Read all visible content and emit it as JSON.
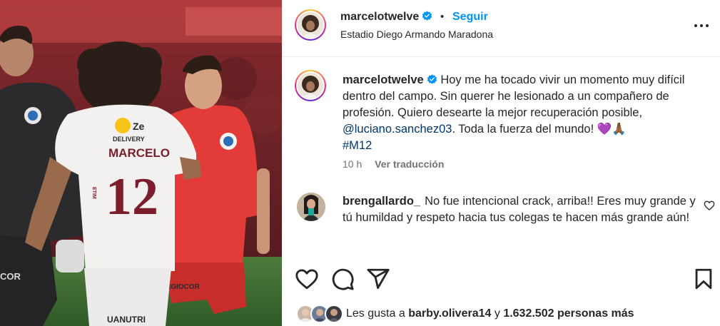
{
  "post": {
    "username": "marcelotwelve",
    "separator": "•",
    "follow_label": "Seguir",
    "location": "Estadio Diego Armando Maradona",
    "caption": {
      "username": "marcelotwelve",
      "text_part1": "Hoy me ha tocado vivir un momento muy difícil dentro del campo. Sin querer he lesionado a un compañero de profesión. Quiero desearte la mejor recuperación posible,",
      "mention": "@luciano.sanchez03",
      "text_part2": ". Toda la fuerza del mundo! 💜🙏🏾",
      "hashtag": "#M12",
      "time": "10 h",
      "translate_label": "Ver traducción"
    },
    "comment": {
      "username": "brengallardo_",
      "text": "No fue intencional crack, arriba!! Eres muy grande y tú humildad y respeto hacia tus colegas te hacen más grande aún!"
    },
    "likes": {
      "prefix": "Les gusta a",
      "user": "barby.olivera14",
      "connector": "y",
      "count": "1.632.502",
      "suffix": "personas más"
    },
    "photo_text": {
      "sponsor": "DELIVERY",
      "sponsor_mark": "Ze",
      "player_name": "MARCELO",
      "number": "12",
      "short_logo": "ETIM",
      "left_player_badge": "COR",
      "bottom_brand": "UANUTRI",
      "right_sponsor": "NGIOCOR"
    }
  },
  "colors": {
    "accent": "#0095f6",
    "link": "#00376b",
    "verified": "#0095f6",
    "secondary_text": "#737373"
  },
  "icons": [
    "verified-icon",
    "more-options-icon",
    "heart-icon",
    "comment-icon",
    "share-icon",
    "bookmark-icon",
    "comment-like-icon"
  ]
}
